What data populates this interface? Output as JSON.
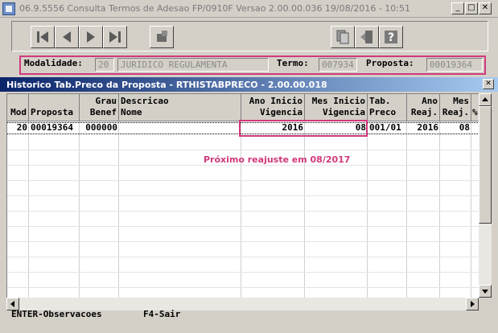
{
  "window": {
    "title": "06.9.5556 Consulta  Termos de Adesao FP/0910F Versao 2.00.00.036 19/08/2016 - 10:51",
    "minimize_label": "_",
    "maximize_label": "□",
    "close_label": "✕"
  },
  "toolbar": {
    "icons": [
      "first-record-icon",
      "previous-record-icon",
      "next-record-icon",
      "last-record-icon",
      "zoom-icon",
      "copy-icon",
      "exit-icon",
      "help-icon"
    ],
    "help_label": "?"
  },
  "filters": {
    "modalidade_label": "Modalidade:",
    "modalidade_code": "20",
    "modalidade_desc": "JURIDICO REGULAMENTA",
    "termo_label": "Termo:",
    "termo_value": "007934",
    "proposta_label": "Proposta:",
    "proposta_value": "00019364"
  },
  "dialog": {
    "title": "Historico Tab.Preco da Proposta - RTHISTABPRECO - 2.00.00.018",
    "close_label": "✕"
  },
  "grid": {
    "headers": [
      "\nMod",
      "\nProposta",
      "Grau\nBenef",
      "Descricao\nNome",
      "Ano Inicio\nVigencia",
      "Mes Inicio\nVigencia",
      "Tab.\nPreco",
      "Ano\nReaj.",
      "Mes\nReaj.",
      "\n%"
    ],
    "rows": [
      [
        "20",
        "00019364",
        "000000",
        "",
        "2016",
        "08",
        "001/01",
        "2016",
        "08",
        ""
      ]
    ]
  },
  "annotation": {
    "text": "Próximo reajuste em 08/2017",
    "color": "#d0397c"
  },
  "status": {
    "enter_label": "ENTER-Observacoes",
    "f4_label": "F4-Sair"
  }
}
